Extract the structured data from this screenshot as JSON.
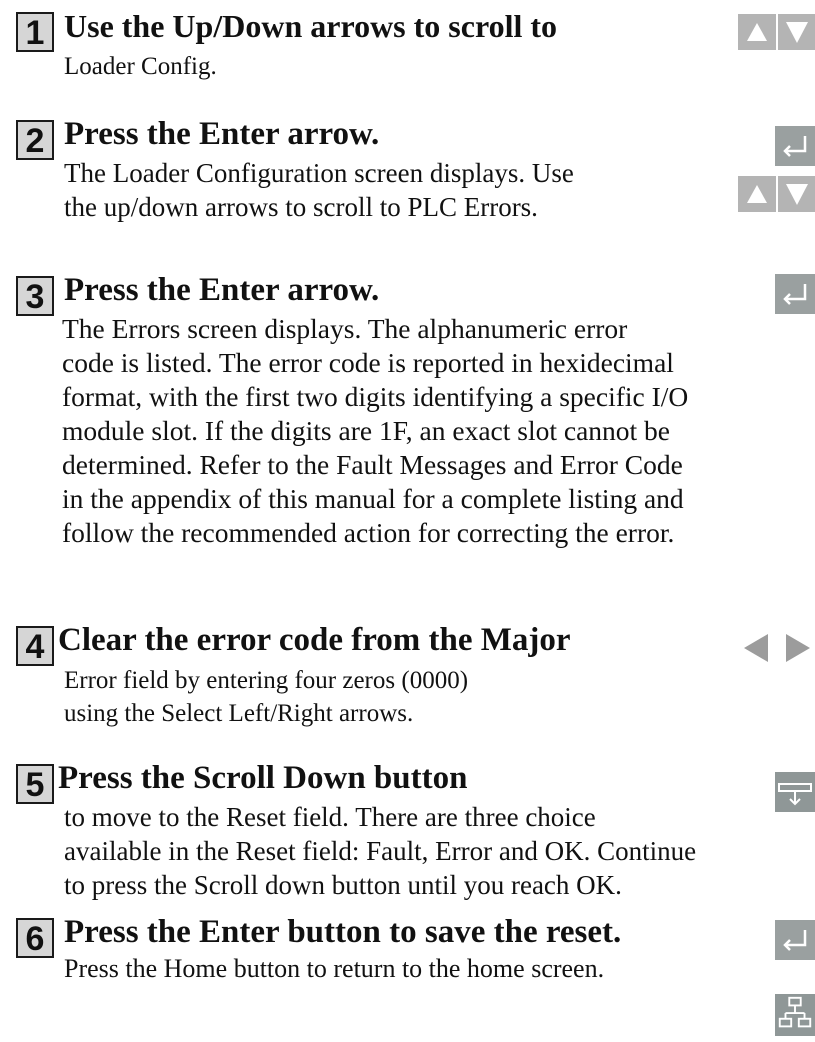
{
  "steps": [
    {
      "num": "1",
      "title": "Use the Up/Down arrows to scroll to",
      "lines": [
        "Loader Config."
      ]
    },
    {
      "num": "2",
      "title": "Press the Enter arrow.",
      "lines": [
        "The Loader Configuration screen displays. Use",
        "the up/down arrows to scroll to PLC Errors."
      ]
    },
    {
      "num": "3",
      "title": "Press the Enter arrow.",
      "lines": [
        "The Errors screen displays. The alphanumeric error",
        "code is listed. The error code is reported in hexidecimal",
        "format, with the first two digits identifying a specific I/O",
        "module slot. If the digits are 1F, an exact slot cannot be",
        "determined. Refer to the Fault Messages and Error Code",
        "in the appendix of this manual for a complete listing and",
        "follow the recommended action for correcting the error."
      ]
    },
    {
      "num": "4",
      "title": "Clear the error code from the Major",
      "lines": [
        "Error field by entering four zeros (0000)",
        "using the Select Left/Right arrows."
      ]
    },
    {
      "num": "5",
      "title": "Press the Scroll Down button",
      "lines": [
        "to move to the Reset field. There are three choice",
        "available in the Reset field: Fault, Error and OK. Continue",
        "to press the Scroll down button until you reach OK."
      ]
    },
    {
      "num": "6",
      "title": "Press the Enter button to save the reset.",
      "lines": [
        "Press the Home button to return to the home screen."
      ]
    }
  ],
  "icons": [
    "up-down-arrows",
    "enter-arrow",
    "left-right-arrows",
    "scroll-down-button",
    "home-button"
  ]
}
